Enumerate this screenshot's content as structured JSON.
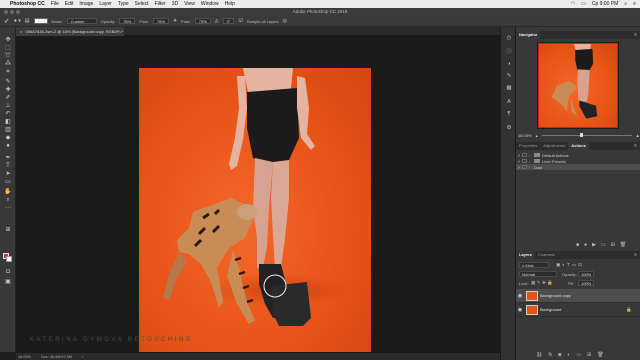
{
  "menubar": {
    "apple": "",
    "app": "Photoshop CC",
    "items": [
      "File",
      "Edit",
      "Image",
      "Layer",
      "Type",
      "Select",
      "Filter",
      "3D",
      "View",
      "Window",
      "Help"
    ],
    "clock": "Cp 9:00 PM"
  },
  "window": {
    "title": "Adobe Photoshop CC 2018"
  },
  "options": {
    "mode_label": "Mode:",
    "mode_value": "Custom",
    "opacity_label": "Opacity:",
    "opacity_value": "76%",
    "flow_label": "Flow:",
    "flow_value": "76%",
    "angle_label": "Angle:",
    "angle_value": "0°",
    "sample_label": "Sample all Layers",
    "pressure_label": "Flow:",
    "pressure_value": "73%"
  },
  "document": {
    "tab_label": "006A7636-2sm-2 @ 18% (Background copy, RGB/8*) *"
  },
  "tools": [
    "move",
    "marquee",
    "lasso",
    "magic-wand",
    "crop",
    "eyedropper",
    "healing",
    "brush",
    "clone-stamp",
    "history-brush",
    "eraser",
    "gradient",
    "blur",
    "dodge",
    "pen",
    "type",
    "path-select",
    "shape",
    "hand",
    "zoom"
  ],
  "watermark": "KATERINA DYMOVA RETOUCHING",
  "status": {
    "zoom": "18.03%",
    "doc": "Doc: 46.4M/92.9M"
  },
  "navigator": {
    "tab": "Navigator",
    "zoom": "18.03%"
  },
  "actions_panel": {
    "tabs": [
      "Properties",
      "Adjustments",
      "Actions"
    ],
    "active_tab": "Actions",
    "rows": [
      {
        "label": "Default Actions",
        "checked": true
      },
      {
        "label": "Liner Presets",
        "checked": true
      },
      {
        "label": "Dust",
        "checked": true
      }
    ]
  },
  "layers_panel": {
    "tabs": [
      "Layers",
      "Channels"
    ],
    "active_tab": "Layers",
    "filter_label": "Kind",
    "blend_mode": "Normal",
    "opacity_label": "Opacity:",
    "opacity_value": "100%",
    "lock_label": "Lock:",
    "fill_label": "Fill:",
    "fill_value": "100%",
    "layers": [
      {
        "name": "Background copy",
        "selected": true,
        "locked": false
      },
      {
        "name": "Background",
        "selected": false,
        "locked": true
      }
    ]
  },
  "colors": {
    "backdrop": "#e85418",
    "foreground_swatch": "#d43a2b",
    "background_swatch": "#ffffff",
    "ui_dark": "#1f1f1f",
    "panel": "#383838"
  }
}
